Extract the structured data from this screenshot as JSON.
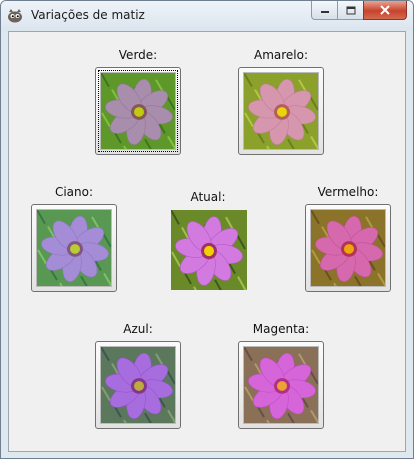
{
  "window": {
    "title": "Variações de matiz",
    "icon": "gimp-wilber-icon"
  },
  "titlebar_buttons": [
    {
      "name": "minimize-button",
      "icon": "minimize-icon"
    },
    {
      "name": "maximize-button",
      "icon": "maximize-icon"
    },
    {
      "name": "close-button",
      "icon": "close-icon"
    }
  ],
  "variations": {
    "verde": {
      "label": "Verde:",
      "tint": "#3fbf2a"
    },
    "amarelo": {
      "label": "Amarelo:",
      "tint": "#e4e030"
    },
    "ciano": {
      "label": "Ciano:",
      "tint": "#2ec0c0"
    },
    "atual": {
      "label": "Atual:",
      "tint": "none"
    },
    "vermelho": {
      "label": "Vermelho:",
      "tint": "#e23a2a"
    },
    "azul": {
      "label": "Azul:",
      "tint": "#3a4ae0"
    },
    "magenta": {
      "label": "Magenta:",
      "tint": "#e030c8"
    }
  },
  "colors": {
    "flower_petal": "#d27ae0",
    "flower_center": "#f0d000",
    "foliage": "#6a8a2a"
  }
}
